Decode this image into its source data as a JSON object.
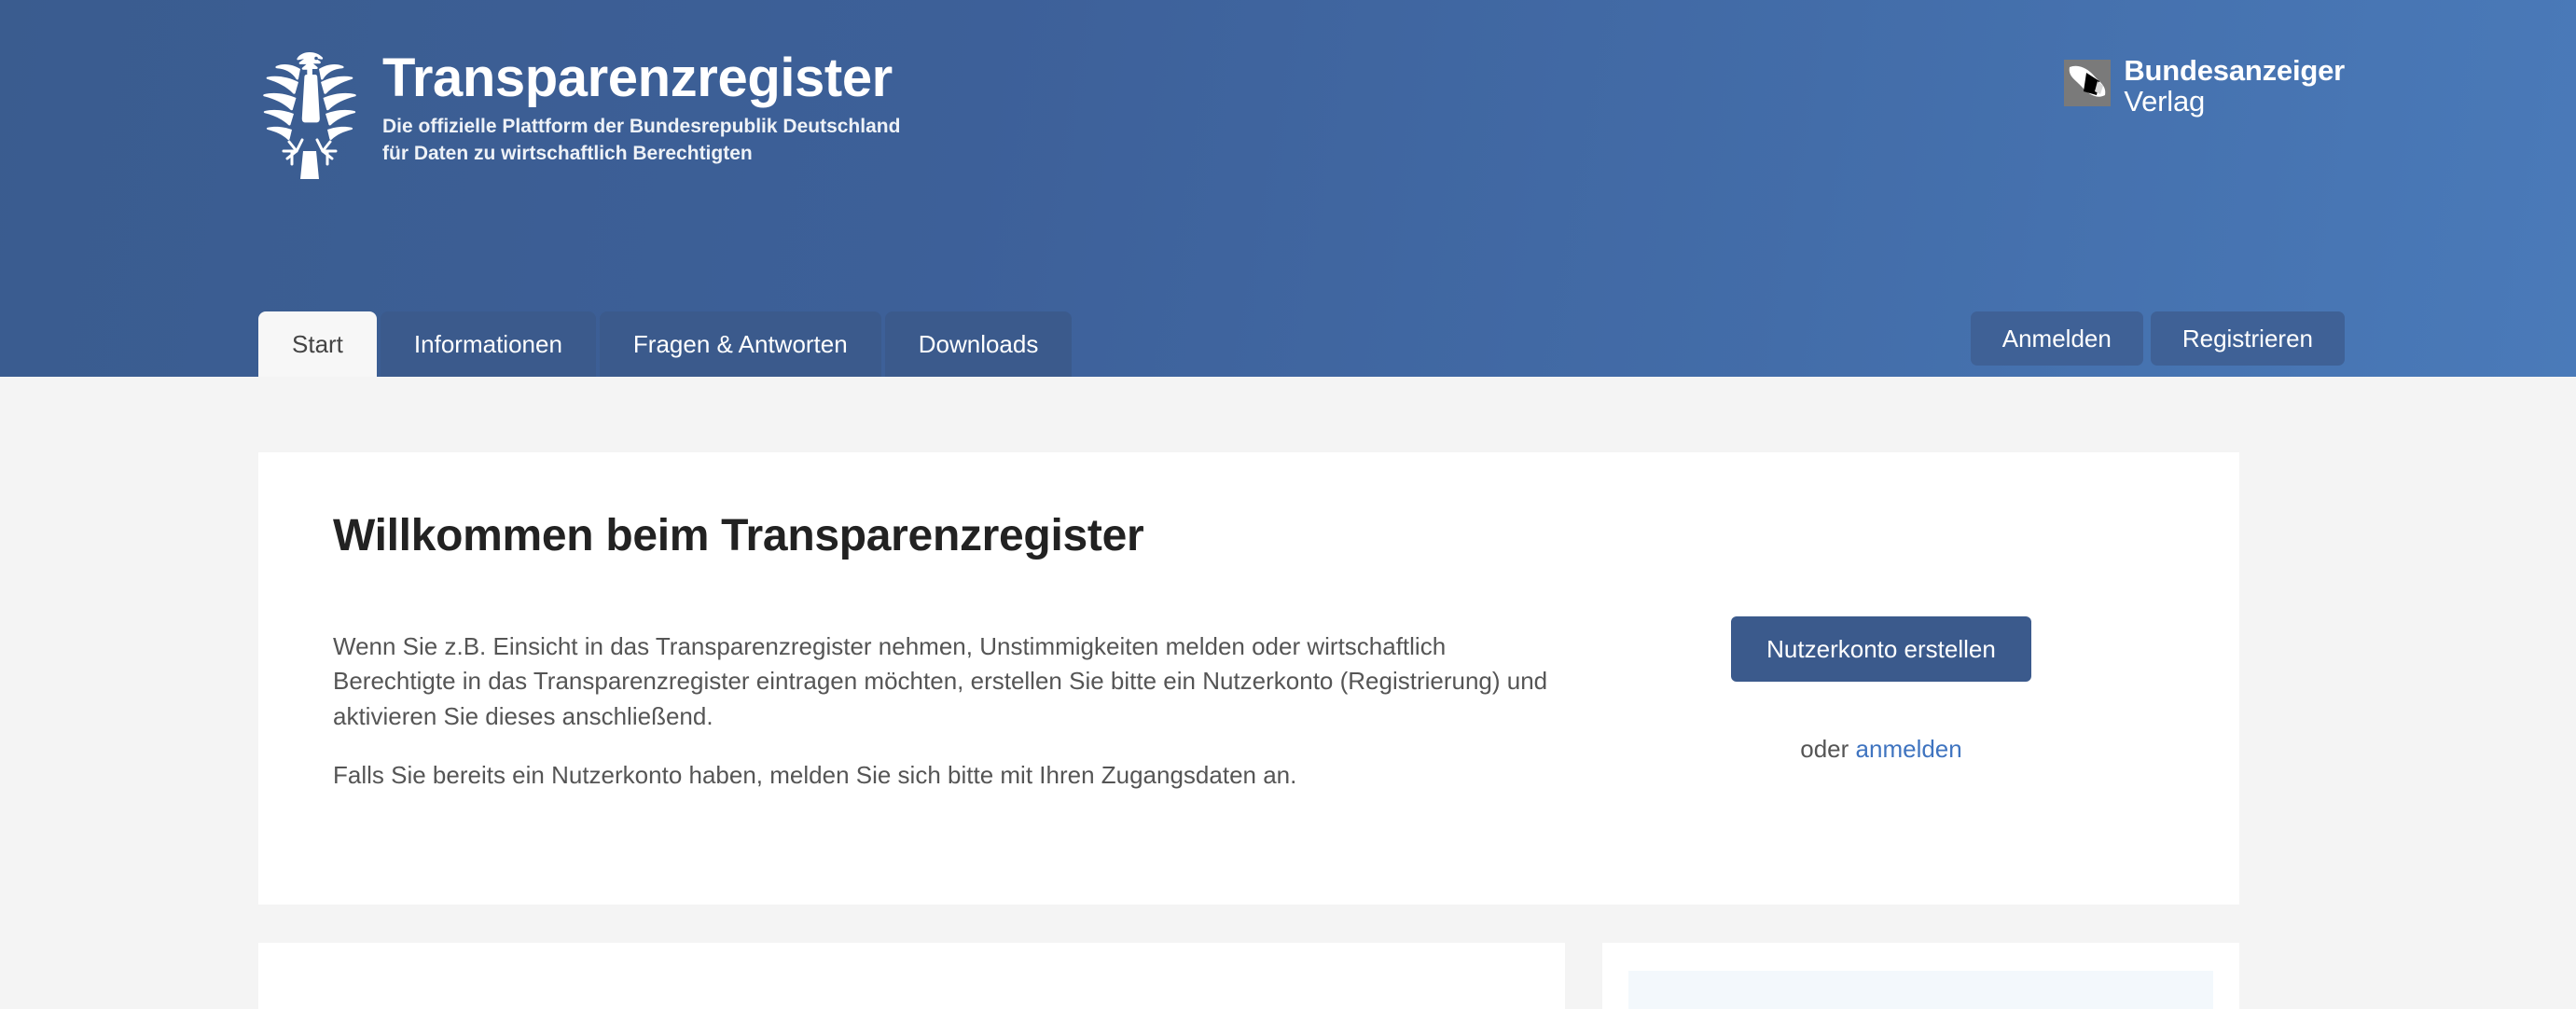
{
  "header": {
    "brand": {
      "title": "Transparenzregister",
      "subtitle_line1": "Die offizielle Plattform der Bundesrepublik Deutschland",
      "subtitle_line2": "für Daten zu wirtschaftlich Berechtigten",
      "eagle_icon": "bundesadler-icon"
    },
    "partner_logo": {
      "line1": "Bundesanzeiger",
      "line2": "Verlag",
      "mark_icon": "bundesanzeiger-mark-icon"
    },
    "gradient_from": "#3a5c8f",
    "gradient_to": "#4a7ab9"
  },
  "nav": {
    "tabs": [
      {
        "label": "Start",
        "active": true
      },
      {
        "label": "Informationen",
        "active": false
      },
      {
        "label": "Fragen & Antworten",
        "active": false
      },
      {
        "label": "Downloads",
        "active": false
      }
    ],
    "actions": [
      {
        "label": "Anmelden"
      },
      {
        "label": "Registrieren"
      }
    ],
    "active_tab_bg": "#f7f7f7",
    "tab_bg": "#3b5a8c"
  },
  "hero": {
    "title": "Willkommen beim Transparenzregister",
    "paragraph1": "Wenn Sie z.B. Einsicht in das Transparenzregister nehmen, Unstimmigkeiten melden oder wirtschaftlich Berechtigte in das Transparenzregister eintragen möchten, erstellen Sie bitte ein Nutzerkonto (Registrierung) und aktivieren Sie dieses anschließend.",
    "paragraph2": "Falls Sie bereits ein Nutzerkonto haben, melden Sie sich bitte mit Ihren Zugangsdaten an.",
    "cta_label": "Nutzerkonto erstellen",
    "alt_prefix": "oder ",
    "alt_link": "anmelden",
    "link_color": "#3f74c0"
  },
  "cards": {
    "left": {
      "label": ""
    },
    "right": {
      "label": "",
      "panel_color": "#f3f8fc"
    }
  }
}
